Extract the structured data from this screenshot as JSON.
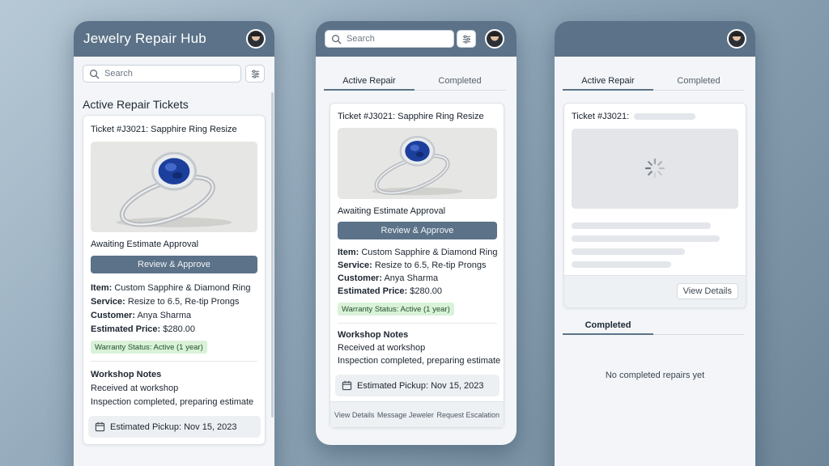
{
  "app": {
    "title": "Jewelry Repair Hub"
  },
  "search": {
    "placeholder": "Search"
  },
  "list": {
    "title": "Active Repair Tickets"
  },
  "tabs": {
    "active": "Active Repair",
    "completed": "Completed"
  },
  "ticket": {
    "title": "Ticket #J3021: Sapphire Ring Resize",
    "id_label": "Ticket #J3021:",
    "status": "Awaiting Estimate Approval",
    "approve_label": "Review & Approve",
    "item_label": "Item:",
    "item_value": "Custom Sapphire & Diamond Ring",
    "service_label": "Service:",
    "service_value": "Resize to 6.5, Re-tip Prongs",
    "customer_label": "Customer:",
    "customer_value": "Anya Sharma",
    "price_label": "Estimated Price:",
    "price_value": "$280.00",
    "warranty": "Warranty Status: Active (1 year)",
    "notes_title": "Workshop Notes",
    "notes": [
      "Received at workshop",
      "Inspection completed, preparing estimate"
    ],
    "pickup": "Estimated Pickup: Nov 15, 2023"
  },
  "actions": {
    "view_details": "View Details",
    "message": "Message Jeweler",
    "escalate": "Request Escalation"
  },
  "completed": {
    "section_title": "Completed",
    "empty": "No completed repairs yet"
  },
  "colors": {
    "header": "#5b7288",
    "accent": "#5b7288",
    "warranty_bg": "#d9f2d8",
    "background": "#8fa6b8"
  },
  "icons": [
    "search-icon",
    "filter-icon",
    "calendar-icon",
    "avatar",
    "spinner-icon"
  ]
}
